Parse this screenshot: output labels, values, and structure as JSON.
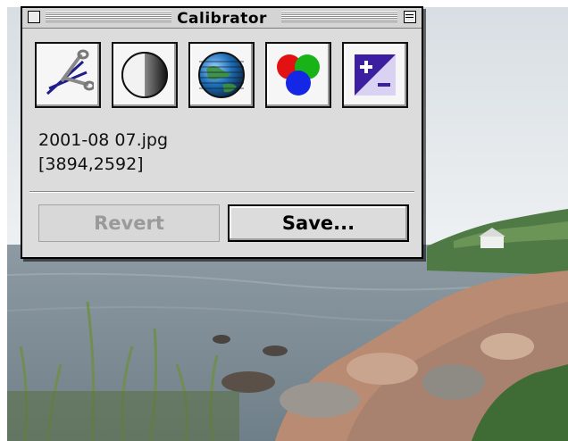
{
  "window": {
    "title": "Calibrator"
  },
  "tools": [
    {
      "name": "crop",
      "icon": "scissors-icon"
    },
    {
      "name": "brightness",
      "icon": "half-circle-icon"
    },
    {
      "name": "globe",
      "icon": "globe-icon"
    },
    {
      "name": "color",
      "icon": "rgb-circles-icon"
    },
    {
      "name": "contrast",
      "icon": "plus-minus-icon"
    }
  ],
  "file": {
    "name": "2001-08 07.jpg",
    "dimensions": "[3894,2592]"
  },
  "buttons": {
    "revert_label": "Revert",
    "save_label": "Save..."
  },
  "colors": {
    "window_bg": "#dcdcdc",
    "contrast_icon": "#3c1fa0",
    "disabled_text": "#9a9a9a"
  }
}
